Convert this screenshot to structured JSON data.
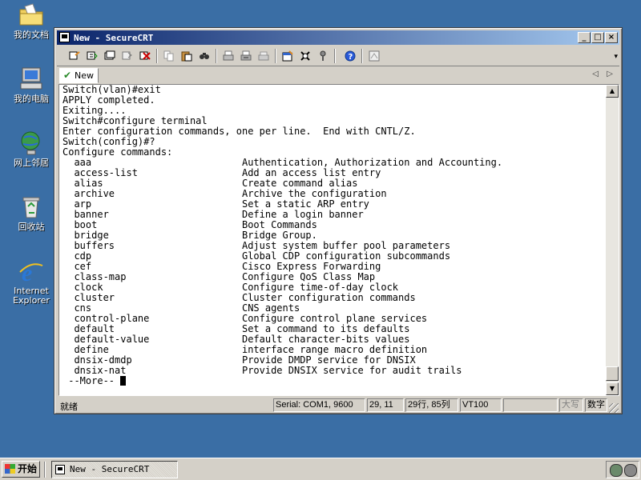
{
  "desktop": {
    "icons": [
      {
        "name": "my-documents",
        "label": "我的文档"
      },
      {
        "name": "my-computer",
        "label": "我的电脑"
      },
      {
        "name": "network-places",
        "label": "网上邻居"
      },
      {
        "name": "recycle-bin",
        "label": "回收站"
      },
      {
        "name": "internet-explorer",
        "label": "Internet Explorer"
      }
    ]
  },
  "window": {
    "title": "New - SecureCRT",
    "controls": {
      "minimize": "_",
      "maximize": "□",
      "close": "×"
    },
    "toolbar_icons": [
      "connect-icon",
      "quick-connect-icon",
      "connect-tab-icon",
      "reconnect-icon",
      "disconnect-icon",
      "copy-icon",
      "paste-icon",
      "find-icon",
      "print-icon",
      "print-selection-icon",
      "print-setup-icon",
      "session-options-icon",
      "global-options-icon",
      "keymap-icon",
      "help-icon",
      "sftp-icon"
    ],
    "tab": {
      "label": "New"
    },
    "terminal_lines": [
      "Switch(vlan)#exit",
      "APPLY completed.",
      "Exiting....",
      "Switch#configure terminal",
      "Enter configuration commands, one per line.  End with CNTL/Z.",
      "Switch(config)#?",
      "Configure commands:",
      "  aaa                          Authentication, Authorization and Accounting.",
      "  access-list                  Add an access list entry",
      "  alias                        Create command alias",
      "  archive                      Archive the configuration",
      "  arp                          Set a static ARP entry",
      "  banner                       Define a login banner",
      "  boot                         Boot Commands",
      "  bridge                       Bridge Group.",
      "  buffers                      Adjust system buffer pool parameters",
      "  cdp                          Global CDP configuration subcommands",
      "  cef                          Cisco Express Forwarding",
      "  class-map                    Configure QoS Class Map",
      "  clock                        Configure time-of-day clock",
      "  cluster                      Cluster configuration commands",
      "  cns                          CNS agents",
      "  control-plane                Configure control plane services",
      "  default                      Set a command to its defaults",
      "  default-value                Default character-bits values",
      "  define                       interface range macro definition",
      "  dnsix-dmdp                   Provide DMDP service for DNSIX",
      "  dnsix-nat                    Provide DNSIX service for audit trails"
    ],
    "more_prompt": " --More-- ",
    "status": {
      "ready": "就绪",
      "serial": "Serial: COM1, 9600",
      "cursor_pos": "29, 11",
      "rows_cols": "29行, 85列",
      "term": "VT100",
      "blank": "",
      "caps": "大写",
      "num": "数字"
    }
  },
  "taskbar": {
    "start_label": "开始",
    "task_label": "New - SecureCRT"
  }
}
